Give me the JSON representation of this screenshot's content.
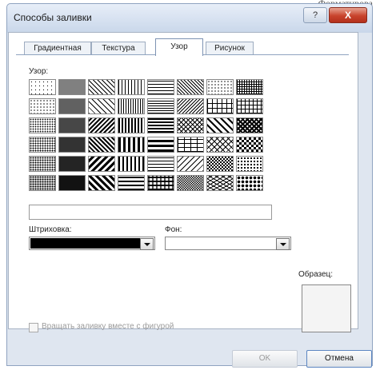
{
  "background_text": "Форматирова",
  "window": {
    "title": "Способы заливки",
    "help_label": "?",
    "close_label": "X"
  },
  "tabs": [
    {
      "label": "Градиентная"
    },
    {
      "label": "Текстура"
    },
    {
      "label": "Узор",
      "active": true
    },
    {
      "label": "Рисунок"
    }
  ],
  "pattern": {
    "label": "Узор:",
    "rows": [
      [
        "dots-5",
        "dots-50",
        "diag-light",
        "vert-light",
        "horiz-light",
        "diag-dash",
        "confetti-small",
        "grid-small"
      ],
      [
        "dots-10",
        "dots-60",
        "diag-wide",
        "vert-narrow",
        "horiz-narrow",
        "diag-dash-2",
        "grid-large",
        "grid-large-2"
      ],
      [
        "dots-20",
        "dots-70",
        "diag-dark",
        "vert-dark",
        "horiz-dark",
        "zigzag",
        "diag-brick",
        "diag-check-small"
      ],
      [
        "dots-25",
        "dots-75",
        "diag-dark-2",
        "vert-wide",
        "horiz-wide",
        "brick",
        "weave",
        "checker-large"
      ],
      [
        "dots-30",
        "dots-80",
        "diag-wide-2",
        "vert-wide-2",
        "horiz-dash",
        "divot",
        "solid-diamond",
        "dotted-grid"
      ],
      [
        "dots-40",
        "dots-90",
        "diag-wide-3",
        "horiz-wide-2",
        "plaid",
        "checker-small",
        "shingle",
        "sphere"
      ]
    ],
    "description": ""
  },
  "foreground": {
    "label": "Штриховка:",
    "color": "#000000"
  },
  "background": {
    "label": "Фон:",
    "color": "#ffffff"
  },
  "sample": {
    "label": "Образец:"
  },
  "rotate_checkbox": {
    "label": "Вращать заливку вместе с фигурой",
    "checked": false,
    "enabled": false
  },
  "buttons": {
    "ok": "OK",
    "cancel": "Отмена"
  },
  "colors": {
    "accent": "#c8432c",
    "frame": "#dfe6f0",
    "disabled_text": "#9b9b9b"
  }
}
